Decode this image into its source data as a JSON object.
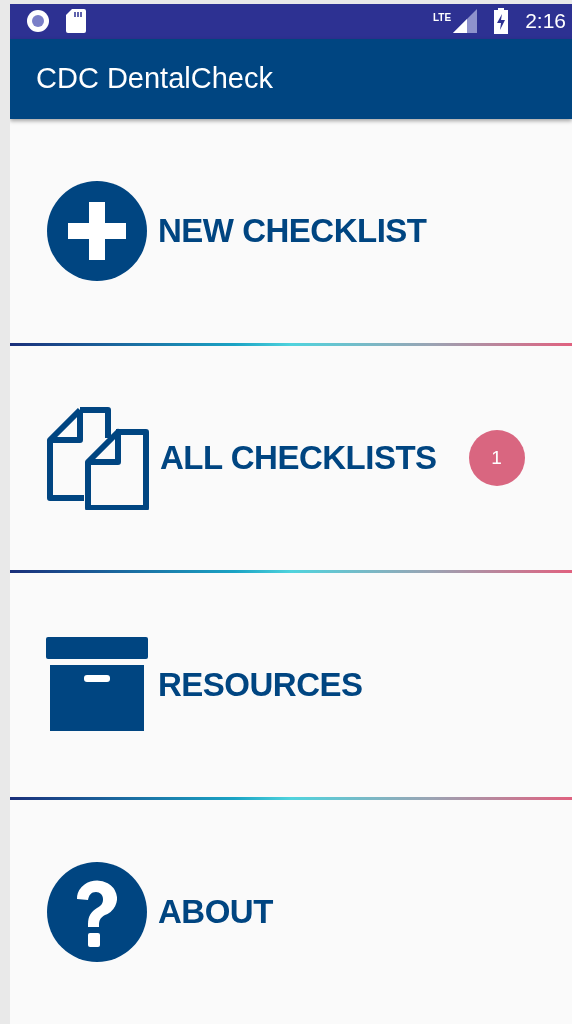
{
  "status_bar": {
    "time": "2:16",
    "network": "LTE"
  },
  "app_bar": {
    "title": "CDC DentalCheck"
  },
  "menu": [
    {
      "kind": "plus",
      "label": "NEW CHECKLIST"
    },
    {
      "kind": "documents",
      "label": "ALL CHECKLISTS",
      "badge": "1"
    },
    {
      "kind": "box",
      "label": "RESOURCES"
    },
    {
      "kind": "question",
      "label": "ABOUT"
    }
  ]
}
